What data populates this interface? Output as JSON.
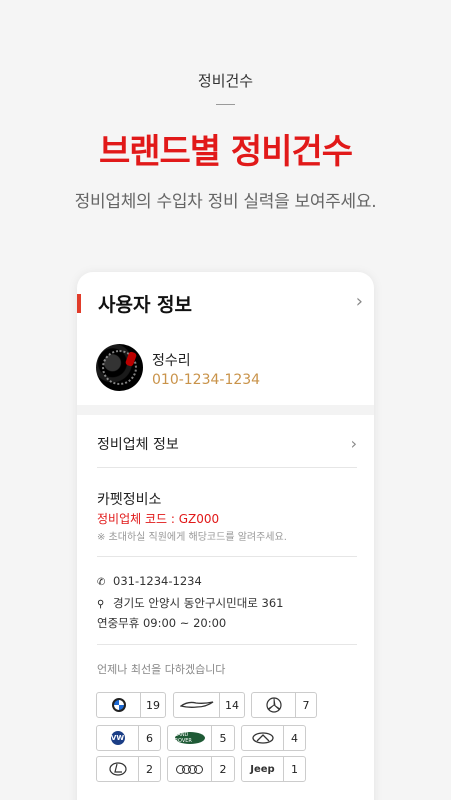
{
  "header": {
    "top_label": "정비건수",
    "headline": "브랜드별 정비건수",
    "subhead": "정비업체의 수입차 정비 실력을 보여주세요."
  },
  "card": {
    "title": "사용자 정보",
    "user": {
      "name": "정수리",
      "phone": "010-1234-1234"
    },
    "shop_section_label": "정비업체 정보",
    "shop": {
      "name": "카펫정비소",
      "code": "정비업체 코드 : GZ000",
      "note": "※ 초대하실 직원에게 해당코드를 알려주세요.",
      "phone": "031-1234-1234",
      "address": "경기도 안양시 동안구시민대로 361",
      "hours": "연중무휴 09:00 ~ 20:00"
    },
    "motto": "언제나 최선을 다하겠습니다",
    "brands": [
      {
        "name": "BMW",
        "icon": "bmw-logo-icon",
        "count": "19"
      },
      {
        "name": "Jaguar",
        "icon": "jaguar-logo-icon",
        "count": "14"
      },
      {
        "name": "Mercedes-Benz",
        "icon": "mercedes-logo-icon",
        "count": "7"
      },
      {
        "name": "Volkswagen",
        "icon": "volkswagen-logo-icon",
        "count": "6"
      },
      {
        "name": "Land Rover",
        "icon": "land-rover-logo-icon",
        "count": "5",
        "logo_text": "LAND ROVER"
      },
      {
        "name": "Infiniti",
        "icon": "infiniti-logo-icon",
        "count": "4"
      },
      {
        "name": "Lexus",
        "icon": "lexus-logo-icon",
        "count": "2"
      },
      {
        "name": "Audi",
        "icon": "audi-logo-icon",
        "count": "2"
      },
      {
        "name": "Jeep",
        "icon": "jeep-logo-icon",
        "count": "1",
        "logo_text": "Jeep"
      }
    ]
  },
  "icons": {
    "chevron": "chevron-right-icon",
    "phone": "phone-icon",
    "location": "location-pin-icon"
  },
  "colors": {
    "accent_red": "#e11919",
    "phone_gold": "#c9934a",
    "accent_bar": "#e13c2a"
  }
}
